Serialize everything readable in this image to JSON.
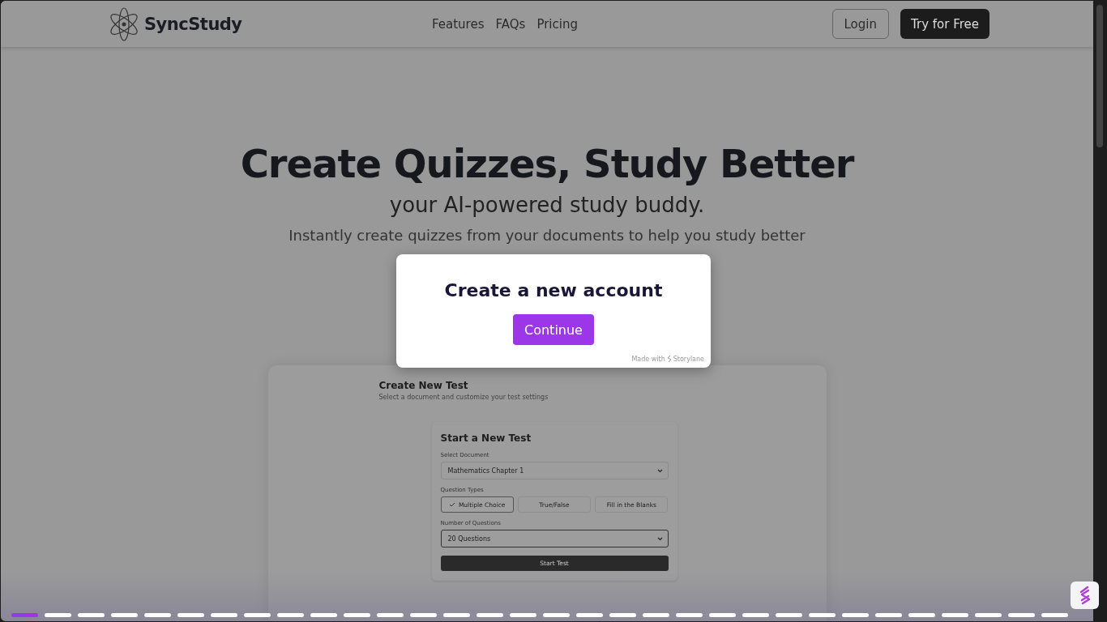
{
  "header": {
    "logo": "SyncStudy",
    "nav": [
      {
        "label": "Features"
      },
      {
        "label": "FAQs"
      },
      {
        "label": "Pricing"
      }
    ],
    "login": "Login",
    "cta": "Try for Free"
  },
  "hero": {
    "title": "Create Quizzes, Study Better",
    "subtitle": "your AI-powered study buddy.",
    "description": "Instantly create quizzes from your documents to help you study better"
  },
  "demo": {
    "heading": "Create New Test",
    "subheading": "Select a document and customize your test settings",
    "form": {
      "title": "Start a New Test",
      "document_label": "Select Document",
      "document_value": "Mathematics Chapter 1",
      "types_label": "Question Types",
      "types": [
        {
          "label": "Multiple Choice",
          "selected": true
        },
        {
          "label": "True/False",
          "selected": false
        },
        {
          "label": "Fill in the Blanks",
          "selected": false
        }
      ],
      "count_label": "Number of Questions",
      "count_value": "20 Questions",
      "start_button": "Start Test"
    }
  },
  "modal": {
    "title": "Create a new account",
    "button": "Continue",
    "credit": "Made with",
    "brand": "Storylane"
  },
  "steps": [
    {
      "selected": true
    },
    {
      "selected": false
    },
    {
      "selected": false
    },
    {
      "selected": false
    },
    {
      "selected": false
    },
    {
      "selected": false
    },
    {
      "selected": false
    },
    {
      "selected": false
    },
    {
      "selected": false
    },
    {
      "selected": false
    },
    {
      "selected": false
    },
    {
      "selected": false
    },
    {
      "selected": false
    },
    {
      "selected": false
    },
    {
      "selected": false
    },
    {
      "selected": false
    },
    {
      "selected": false
    },
    {
      "selected": false
    },
    {
      "selected": false
    },
    {
      "selected": false
    },
    {
      "selected": false
    },
    {
      "selected": false
    },
    {
      "selected": false
    },
    {
      "selected": false
    },
    {
      "selected": false
    },
    {
      "selected": false
    },
    {
      "selected": false
    },
    {
      "selected": false
    },
    {
      "selected": false
    },
    {
      "selected": false
    },
    {
      "selected": false
    },
    {
      "selected": false
    }
  ]
}
